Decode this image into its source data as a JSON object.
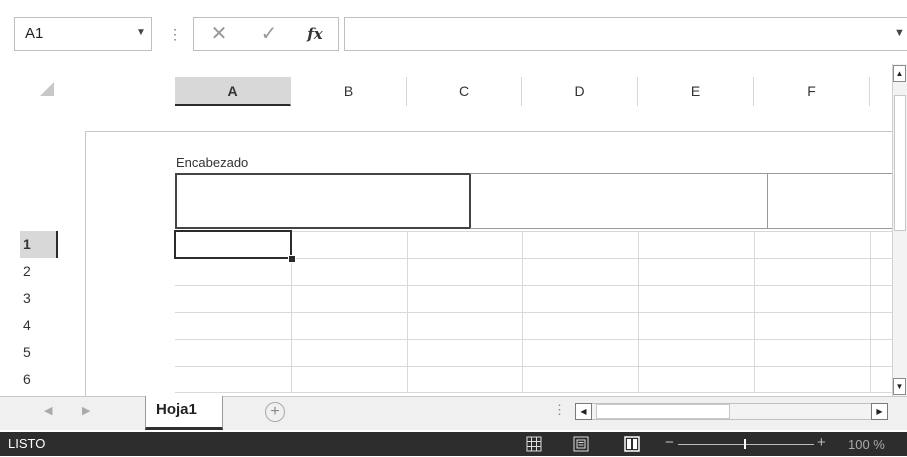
{
  "formula_bar": {
    "name_box": "A1",
    "cancel_glyph": "✕",
    "enter_glyph": "✓",
    "fx_label": "fx",
    "formula_value": ""
  },
  "columns": [
    "A",
    "B",
    "C",
    "D",
    "E",
    "F"
  ],
  "selected_column": "A",
  "page_header": {
    "label": "Encabezado"
  },
  "rows": [
    "1",
    "2",
    "3",
    "4",
    "5",
    "6"
  ],
  "selected_row": "1",
  "sheet_tabs": {
    "tabs": [
      "Hoja1"
    ],
    "add_glyph": "+"
  },
  "status_bar": {
    "status": "LISTO",
    "zoom": "100 %"
  }
}
